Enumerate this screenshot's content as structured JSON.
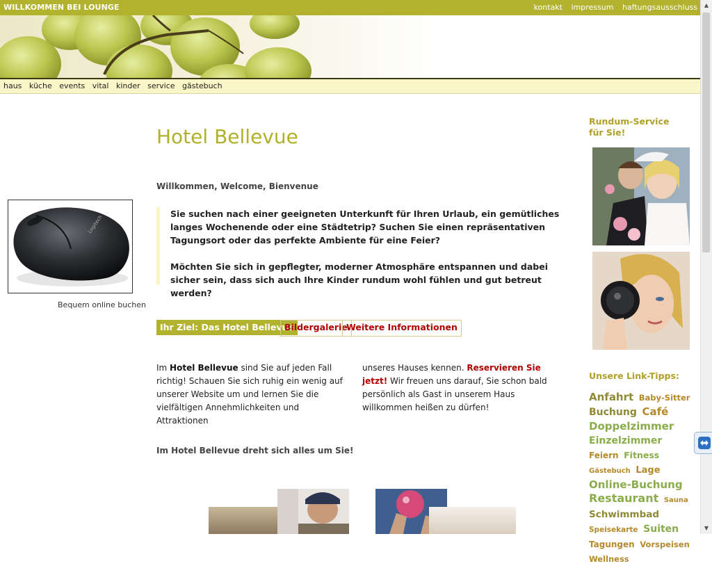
{
  "header": {
    "site_title": "WILLKOMMEN BEI LOUNGE",
    "top_links": [
      "kontakt",
      "impressum",
      "haftungsausschluss"
    ]
  },
  "nav": {
    "items": [
      "haus",
      "küche",
      "events",
      "vital",
      "kinder",
      "service",
      "gästebuch"
    ]
  },
  "left": {
    "caption": "Bequem online buchen",
    "mouse_brand": "Logitech"
  },
  "main": {
    "title": "Hotel Bellevue",
    "greeting": "Willkommen, Welcome, Bienvenue",
    "quote_p1": "Sie suchen nach einer geeigneten Unterkunft für Ihren Urlaub, ein gemütliches langes Wochenende oder eine Städtetrip? Suchen Sie einen repräsentativen Tagungsort oder das perfekte Ambiente für eine Feier?",
    "quote_p2": "Möchten Sie sich in gepflegter, moderner Atmosphäre entspannen und dabei sicher sein, dass sich auch Ihre Kinder rundum wohl fühlen und gut betreut werden?",
    "tabs": [
      "Ihr Ziel: Das Hotel Bellevue",
      "Bildergalerie",
      "Weitere Informationen"
    ],
    "col1_a": "Im ",
    "col1_hotel": "Hotel Bellevue",
    "col1_b": " sind Sie auf jeden Fall richtig! Schauen Sie sich ruhig ein wenig auf unserer Website um und lernen Sie die vielfältigen Annehmlichkeiten und Attraktionen",
    "col2_a": "unseres Hauses kennen. ",
    "col2_reserve": "Reservieren Sie jetzt!",
    "col2_b": " Wir freuen uns darauf, Sie schon bald persönlich als Gast in unserem Haus willkommen heißen zu dürfen!",
    "slogan": "Im Hotel Bellevue dreht sich alles um Sie!"
  },
  "sidebar": {
    "service_title": "Rundum-Service für Sie!",
    "link_title": "Unsere Link-Tipps:",
    "tags": [
      {
        "text": "Anfahrt",
        "size": 15,
        "color": "olive"
      },
      {
        "text": "Baby-Sitter",
        "size": 11.5,
        "color": "gold"
      },
      {
        "text": "Buchung",
        "size": 14,
        "color": "olive"
      },
      {
        "text": "Café",
        "size": 15,
        "color": "gold"
      },
      {
        "text": "Doppelzimmer",
        "size": 15,
        "color": "green"
      },
      {
        "text": "Einzelzimmer",
        "size": 14,
        "color": "green"
      },
      {
        "text": "Feiern",
        "size": 12,
        "color": "gold"
      },
      {
        "text": "Fitness",
        "size": 12.5,
        "color": "green"
      },
      {
        "text": "Gästebuch",
        "size": 10,
        "color": "gold"
      },
      {
        "text": "Lage",
        "size": 13,
        "color": "gold"
      },
      {
        "text": "Online-Buchung",
        "size": 15,
        "color": "green"
      },
      {
        "text": "Restaurant",
        "size": 16,
        "color": "green"
      },
      {
        "text": "Sauna",
        "size": 10,
        "color": "gold"
      },
      {
        "text": "Schwimmbad",
        "size": 13.5,
        "color": "olive"
      },
      {
        "text": "Speisekarte",
        "size": 10.5,
        "color": "gold"
      },
      {
        "text": "Suiten",
        "size": 14,
        "color": "green"
      },
      {
        "text": "Tagungen",
        "size": 12,
        "color": "gold"
      },
      {
        "text": "Vorspeisen",
        "size": 11.5,
        "color": "gold"
      },
      {
        "text": "Wellness",
        "size": 11.5,
        "color": "gold"
      }
    ]
  },
  "colors": {
    "accent": "#b2b22e",
    "title": "#b0b02a",
    "link_red": "#b00000",
    "nav_bg": "#fbf6c8"
  }
}
